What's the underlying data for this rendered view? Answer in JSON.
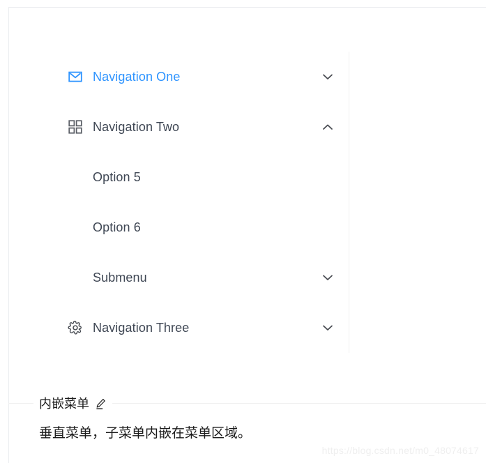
{
  "menu": {
    "items": [
      {
        "key": "sub1",
        "label": "Navigation One",
        "icon": "mail-icon",
        "arrow": "chevron-down-icon",
        "selected": true,
        "expanded": false,
        "children": []
      },
      {
        "key": "sub2",
        "label": "Navigation Two",
        "icon": "appstore-grid-icon",
        "arrow": "chevron-up-icon",
        "selected": false,
        "expanded": true,
        "children": [
          {
            "key": "opt5",
            "label": "Option 5",
            "arrow": ""
          },
          {
            "key": "opt6",
            "label": "Option 6",
            "arrow": ""
          },
          {
            "key": "sub3",
            "label": "Submenu",
            "arrow": "chevron-down-icon"
          }
        ]
      },
      {
        "key": "sub4",
        "label": "Navigation Three",
        "icon": "setting-gear-icon",
        "arrow": "chevron-down-icon",
        "selected": false,
        "expanded": false,
        "children": []
      }
    ]
  },
  "code_box": {
    "title": "内嵌菜单",
    "edit_icon": "pencil-edit-icon",
    "description": "垂直菜单，子菜单内嵌在菜单区域。"
  },
  "watermark": {
    "text": "https://blog.csdn.net/m0_48074617"
  },
  "colors": {
    "selected_blue": "#2e94ff",
    "text_default": "#3f4754",
    "border": "#f0f0f0",
    "card_border": "#ebedf0",
    "watermark": "#efefef"
  }
}
